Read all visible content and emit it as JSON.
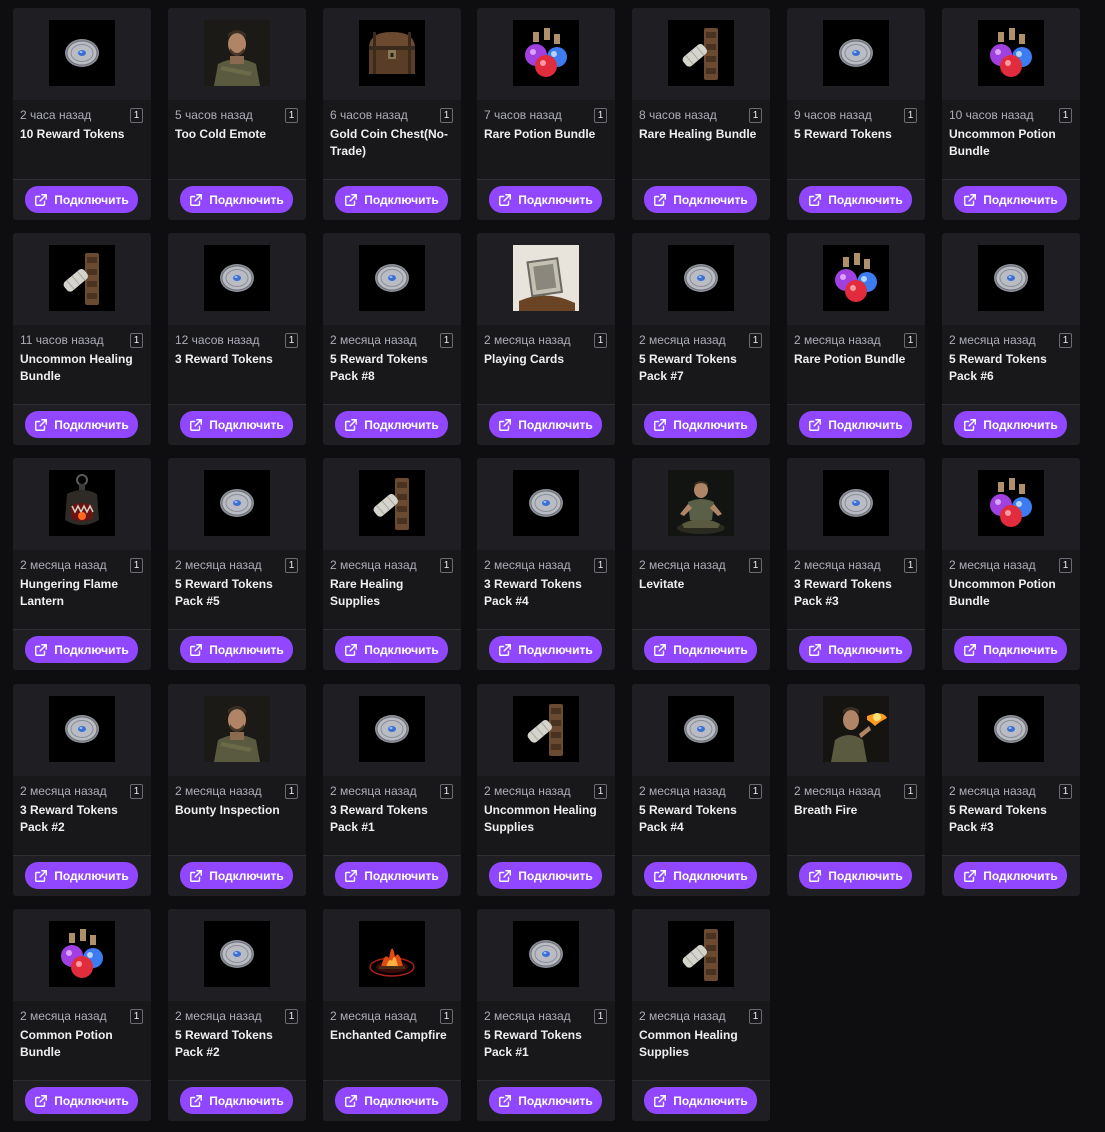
{
  "connect_label": "Подключить",
  "drops": [
    {
      "time": "2 часа назад",
      "qty": "1",
      "name": "10 Reward Tokens",
      "icon": "token"
    },
    {
      "time": "5 часов назад",
      "qty": "1",
      "name": "Too Cold Emote",
      "icon": "soldier"
    },
    {
      "time": "6 часов назад",
      "qty": "1",
      "name": "Gold Coin Chest(No-Trade)",
      "icon": "chest"
    },
    {
      "time": "7 часов назад",
      "qty": "1",
      "name": "Rare Potion Bundle",
      "icon": "potion"
    },
    {
      "time": "8 часов назад",
      "qty": "1",
      "name": "Rare Healing Bundle",
      "icon": "healing"
    },
    {
      "time": "9 часов назад",
      "qty": "1",
      "name": "5 Reward Tokens",
      "icon": "token"
    },
    {
      "time": "10 часов назад",
      "qty": "1",
      "name": "Uncommon Potion Bundle",
      "icon": "potion"
    },
    {
      "time": "11 часов назад",
      "qty": "1",
      "name": "Uncommon Healing Bundle",
      "icon": "healing"
    },
    {
      "time": "12 часов назад",
      "qty": "1",
      "name": "3 Reward Tokens",
      "icon": "token"
    },
    {
      "time": "2 месяца назад",
      "qty": "1",
      "name": "5 Reward Tokens Pack #8",
      "icon": "token"
    },
    {
      "time": "2 месяца назад",
      "qty": "1",
      "name": "Playing Cards",
      "icon": "cards"
    },
    {
      "time": "2 месяца назад",
      "qty": "1",
      "name": "5 Reward Tokens Pack #7",
      "icon": "token"
    },
    {
      "time": "2 месяца назад",
      "qty": "1",
      "name": "Rare Potion Bundle",
      "icon": "potion"
    },
    {
      "time": "2 месяца назад",
      "qty": "1",
      "name": "5 Reward Tokens Pack #6",
      "icon": "token"
    },
    {
      "time": "2 месяца назад",
      "qty": "1",
      "name": "Hungering Flame Lantern",
      "icon": "lantern"
    },
    {
      "time": "2 месяца назад",
      "qty": "1",
      "name": "5 Reward Tokens Pack #5",
      "icon": "token"
    },
    {
      "time": "2 месяца назад",
      "qty": "1",
      "name": "Rare Healing Supplies",
      "icon": "healing"
    },
    {
      "time": "2 месяца назад",
      "qty": "1",
      "name": "3 Reward Tokens Pack #4",
      "icon": "token"
    },
    {
      "time": "2 месяца назад",
      "qty": "1",
      "name": "Levitate",
      "icon": "levitate"
    },
    {
      "time": "2 месяца назад",
      "qty": "1",
      "name": "3 Reward Tokens Pack #3",
      "icon": "token"
    },
    {
      "time": "2 месяца назад",
      "qty": "1",
      "name": "Uncommon Potion Bundle",
      "icon": "potion"
    },
    {
      "time": "2 месяца назад",
      "qty": "1",
      "name": "3 Reward Tokens Pack #2",
      "icon": "token"
    },
    {
      "time": "2 месяца назад",
      "qty": "1",
      "name": "Bounty Inspection",
      "icon": "soldier"
    },
    {
      "time": "2 месяца назад",
      "qty": "1",
      "name": "3 Reward Tokens Pack #1",
      "icon": "token"
    },
    {
      "time": "2 месяца назад",
      "qty": "1",
      "name": "Uncommon Healing Supplies",
      "icon": "healing"
    },
    {
      "time": "2 месяца назад",
      "qty": "1",
      "name": "5 Reward Tokens Pack #4",
      "icon": "token"
    },
    {
      "time": "2 месяца назад",
      "qty": "1",
      "name": "Breath Fire",
      "icon": "firebreath"
    },
    {
      "time": "2 месяца назад",
      "qty": "1",
      "name": "5 Reward Tokens Pack #3",
      "icon": "token"
    },
    {
      "time": "2 месяца назад",
      "qty": "1",
      "name": "Common Potion Bundle",
      "icon": "potion"
    },
    {
      "time": "2 месяца назад",
      "qty": "1",
      "name": "5 Reward Tokens Pack #2",
      "icon": "token"
    },
    {
      "time": "2 месяца назад",
      "qty": "1",
      "name": "Enchanted Campfire",
      "icon": "campfire"
    },
    {
      "time": "2 месяца назад",
      "qty": "1",
      "name": "5 Reward Tokens Pack #1",
      "icon": "token"
    },
    {
      "time": "2 месяца назад",
      "qty": "1",
      "name": "Common Healing Supplies",
      "icon": "healing"
    }
  ],
  "colors": {
    "page_bg": "#0e0e10",
    "card_bg": "#1f1f23",
    "button": "#9147ff",
    "text": "#efeff1",
    "muted": "#adadb8"
  }
}
